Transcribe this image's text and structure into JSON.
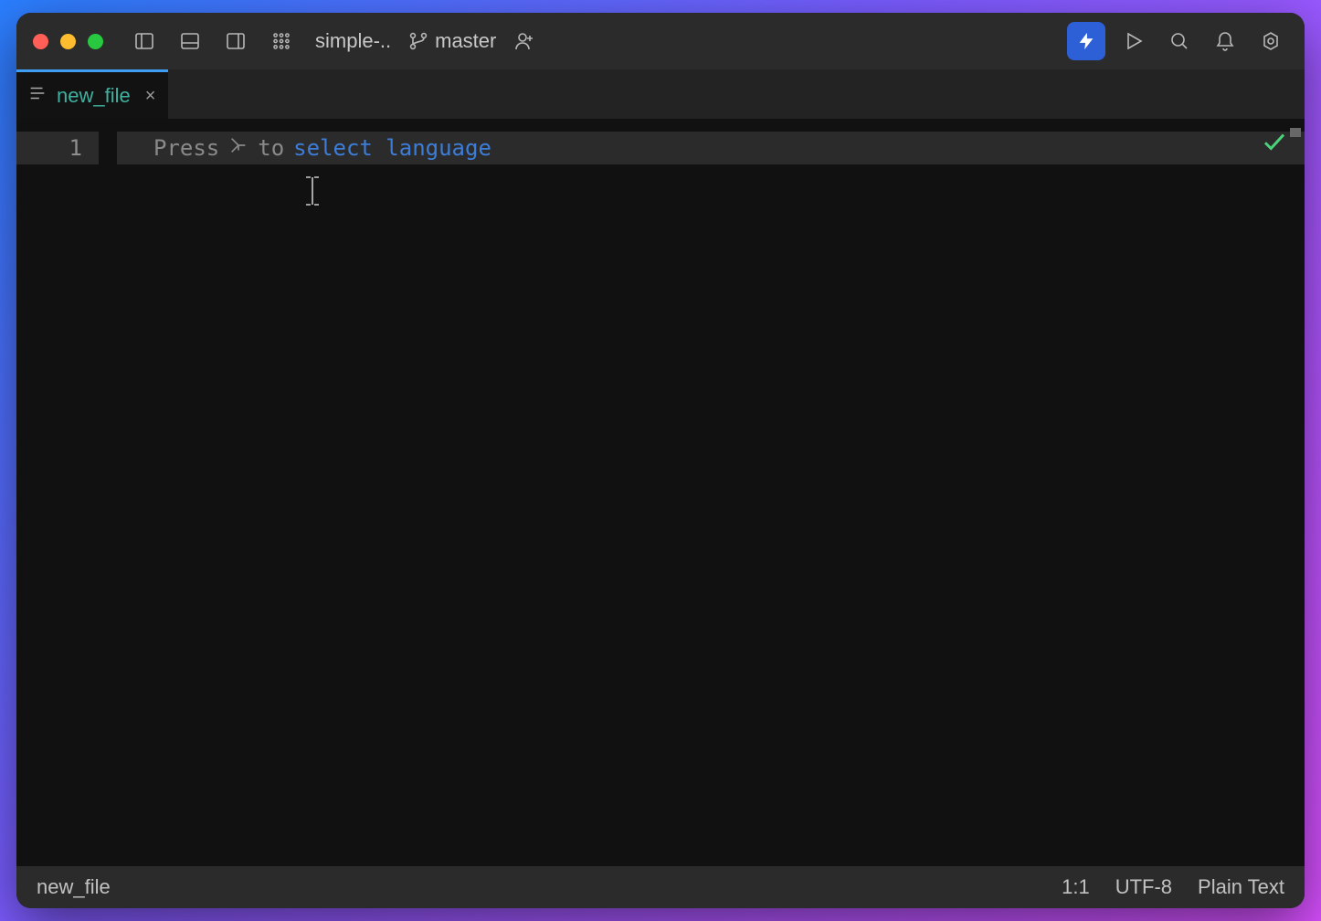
{
  "titlebar": {
    "project_name": "simple-..",
    "branch": "master"
  },
  "tabs": [
    {
      "name": "new_file"
    }
  ],
  "editor": {
    "line_number": "1",
    "hint_prefix": "Press",
    "hint_mid": "to",
    "hint_link": "select language"
  },
  "statusbar": {
    "filename": "new_file",
    "position": "1:1",
    "encoding": "UTF-8",
    "language": "Plain Text"
  }
}
